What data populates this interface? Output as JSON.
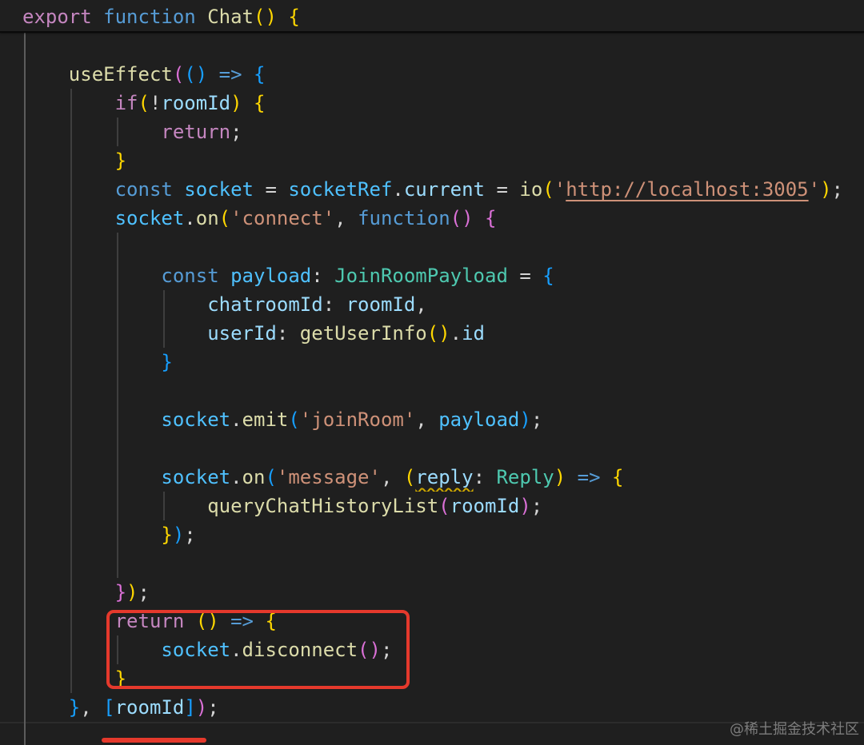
{
  "theme": {
    "background": "#1f1f1f",
    "annotation_red": "#e5392c",
    "warning_squiggle": "#cca700",
    "token_colors": {
      "keyword": "#c586c0",
      "storage": "#569cd6",
      "function": "#dcdcaa",
      "variable": "#9cdcfe",
      "variable-warning": "#9cdcfe",
      "constant": "#4fc1ff",
      "type": "#4ec9b0",
      "string": "#ce9178",
      "link": "#ce9178",
      "punct": "#d4d4d4",
      "bracket1": "#ffd700",
      "bracket2": "#da70d6",
      "bracket3": "#179fff"
    }
  },
  "sticky_scroll": {
    "lines": [
      {
        "tokens": [
          [
            "export",
            "keyword"
          ],
          [
            " ",
            "punct"
          ],
          [
            "function",
            "storage"
          ],
          [
            " ",
            "punct"
          ],
          [
            "Chat",
            "function"
          ],
          [
            "(",
            "bracket1"
          ],
          [
            ")",
            "bracket1"
          ],
          [
            " ",
            "punct"
          ],
          [
            "{",
            "bracket1"
          ]
        ]
      }
    ]
  },
  "editor": {
    "lines": [
      {
        "tokens": []
      },
      {
        "tokens": [
          [
            "    ",
            "ws"
          ],
          [
            "useEffect",
            "function"
          ],
          [
            "(",
            "bracket2"
          ],
          [
            "(",
            "bracket3"
          ],
          [
            ")",
            "bracket3"
          ],
          [
            " ",
            "punct"
          ],
          [
            "=>",
            "storage"
          ],
          [
            " ",
            "punct"
          ],
          [
            "{",
            "bracket3"
          ]
        ]
      },
      {
        "tokens": [
          [
            "        ",
            "ws"
          ],
          [
            "if",
            "keyword"
          ],
          [
            "(",
            "bracket1"
          ],
          [
            "!",
            "punct"
          ],
          [
            "roomId",
            "variable"
          ],
          [
            ")",
            "bracket1"
          ],
          [
            " ",
            "punct"
          ],
          [
            "{",
            "bracket1"
          ]
        ]
      },
      {
        "tokens": [
          [
            "            ",
            "ws"
          ],
          [
            "return",
            "keyword"
          ],
          [
            ";",
            "punct"
          ]
        ]
      },
      {
        "tokens": [
          [
            "        ",
            "ws"
          ],
          [
            "}",
            "bracket1"
          ]
        ]
      },
      {
        "tokens": [
          [
            "        ",
            "ws"
          ],
          [
            "const",
            "storage"
          ],
          [
            " ",
            "punct"
          ],
          [
            "socket",
            "constant"
          ],
          [
            " = ",
            "punct"
          ],
          [
            "socketRef",
            "constant"
          ],
          [
            ".",
            "punct"
          ],
          [
            "current",
            "variable"
          ],
          [
            " = ",
            "punct"
          ],
          [
            "io",
            "function"
          ],
          [
            "(",
            "bracket1"
          ],
          [
            "'",
            "string"
          ],
          [
            "http://localhost:3005",
            "link"
          ],
          [
            "'",
            "string"
          ],
          [
            ")",
            "bracket1"
          ],
          [
            ";",
            "punct"
          ]
        ]
      },
      {
        "tokens": [
          [
            "        ",
            "ws"
          ],
          [
            "socket",
            "constant"
          ],
          [
            ".",
            "punct"
          ],
          [
            "on",
            "function"
          ],
          [
            "(",
            "bracket1"
          ],
          [
            "'connect'",
            "string"
          ],
          [
            ", ",
            "punct"
          ],
          [
            "function",
            "storage"
          ],
          [
            "(",
            "bracket2"
          ],
          [
            ")",
            "bracket2"
          ],
          [
            " ",
            "punct"
          ],
          [
            "{",
            "bracket2"
          ]
        ]
      },
      {
        "tokens": []
      },
      {
        "tokens": [
          [
            "            ",
            "ws"
          ],
          [
            "const",
            "storage"
          ],
          [
            " ",
            "punct"
          ],
          [
            "payload",
            "constant"
          ],
          [
            ": ",
            "punct"
          ],
          [
            "JoinRoomPayload",
            "type"
          ],
          [
            " = ",
            "punct"
          ],
          [
            "{",
            "bracket3"
          ]
        ]
      },
      {
        "tokens": [
          [
            "                ",
            "ws"
          ],
          [
            "chatroomId",
            "variable"
          ],
          [
            ": ",
            "punct"
          ],
          [
            "roomId",
            "variable"
          ],
          [
            ",",
            "punct"
          ]
        ]
      },
      {
        "tokens": [
          [
            "                ",
            "ws"
          ],
          [
            "userId",
            "variable"
          ],
          [
            ": ",
            "punct"
          ],
          [
            "getUserInfo",
            "function"
          ],
          [
            "(",
            "bracket1"
          ],
          [
            ")",
            "bracket1"
          ],
          [
            ".",
            "punct"
          ],
          [
            "id",
            "variable"
          ]
        ]
      },
      {
        "tokens": [
          [
            "            ",
            "ws"
          ],
          [
            "}",
            "bracket3"
          ]
        ]
      },
      {
        "tokens": []
      },
      {
        "tokens": [
          [
            "            ",
            "ws"
          ],
          [
            "socket",
            "constant"
          ],
          [
            ".",
            "punct"
          ],
          [
            "emit",
            "function"
          ],
          [
            "(",
            "bracket3"
          ],
          [
            "'joinRoom'",
            "string"
          ],
          [
            ", ",
            "punct"
          ],
          [
            "payload",
            "constant"
          ],
          [
            ")",
            "bracket3"
          ],
          [
            ";",
            "punct"
          ]
        ]
      },
      {
        "tokens": []
      },
      {
        "tokens": [
          [
            "            ",
            "ws"
          ],
          [
            "socket",
            "constant"
          ],
          [
            ".",
            "punct"
          ],
          [
            "on",
            "function"
          ],
          [
            "(",
            "bracket3"
          ],
          [
            "'message'",
            "string"
          ],
          [
            ", ",
            "punct"
          ],
          [
            "(",
            "bracket1"
          ],
          [
            "reply",
            "variable-warning"
          ],
          [
            ": ",
            "punct"
          ],
          [
            "Reply",
            "type"
          ],
          [
            ")",
            "bracket1"
          ],
          [
            " ",
            "punct"
          ],
          [
            "=>",
            "storage"
          ],
          [
            " ",
            "punct"
          ],
          [
            "{",
            "bracket1"
          ]
        ]
      },
      {
        "tokens": [
          [
            "                ",
            "ws"
          ],
          [
            "queryChatHistoryList",
            "function"
          ],
          [
            "(",
            "bracket2"
          ],
          [
            "roomId",
            "variable"
          ],
          [
            ")",
            "bracket2"
          ],
          [
            ";",
            "punct"
          ]
        ]
      },
      {
        "tokens": [
          [
            "            ",
            "ws"
          ],
          [
            "}",
            "bracket1"
          ],
          [
            ")",
            "bracket3"
          ],
          [
            ";",
            "punct"
          ]
        ]
      },
      {
        "tokens": []
      },
      {
        "tokens": [
          [
            "        ",
            "ws"
          ],
          [
            "}",
            "bracket2"
          ],
          [
            ")",
            "bracket1"
          ],
          [
            ";",
            "punct"
          ]
        ]
      },
      {
        "tokens": [
          [
            "        ",
            "ws"
          ],
          [
            "return",
            "keyword"
          ],
          [
            " ",
            "punct"
          ],
          [
            "(",
            "bracket1"
          ],
          [
            ")",
            "bracket1"
          ],
          [
            " ",
            "punct"
          ],
          [
            "=>",
            "storage"
          ],
          [
            " ",
            "punct"
          ],
          [
            "{",
            "bracket1"
          ]
        ]
      },
      {
        "tokens": [
          [
            "            ",
            "ws"
          ],
          [
            "socket",
            "constant"
          ],
          [
            ".",
            "punct"
          ],
          [
            "disconnect",
            "function"
          ],
          [
            "(",
            "bracket2"
          ],
          [
            ")",
            "bracket2"
          ],
          [
            ";",
            "punct"
          ]
        ]
      },
      {
        "tokens": [
          [
            "        ",
            "ws"
          ],
          [
            "}",
            "bracket1"
          ]
        ]
      },
      {
        "tokens": [
          [
            "    ",
            "ws"
          ],
          [
            "}",
            "bracket3"
          ],
          [
            ", ",
            "punct"
          ],
          [
            "[",
            "bracket3"
          ],
          [
            "roomId",
            "variable"
          ],
          [
            "]",
            "bracket3"
          ],
          [
            ")",
            "bracket2"
          ],
          [
            ";",
            "punct"
          ]
        ]
      }
    ]
  },
  "watermark": {
    "text": "@稀土掘金技术社区"
  }
}
